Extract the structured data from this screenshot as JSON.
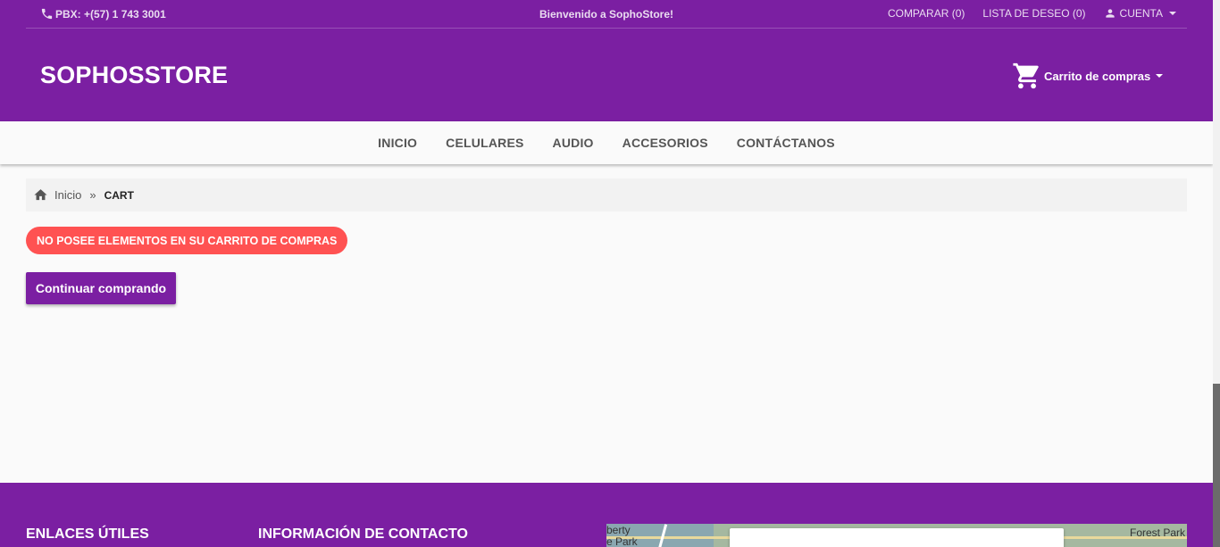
{
  "topbar": {
    "phone": "PBX: +(57) 1 743 3001",
    "welcome": "Bienvenido a SophoStore!",
    "compare": "COMPARAR (0)",
    "wishlist": "LISTA DE DESEO (0)",
    "account": "CUENTA"
  },
  "header": {
    "logo": "SOPHOSSTORE",
    "cart": "Carrito de compras"
  },
  "nav": {
    "items": [
      "INICIO",
      "CELULARES",
      "AUDIO",
      "ACCESORIOS",
      "CONTÁCTANOS"
    ]
  },
  "breadcrumb": {
    "home": "Inicio",
    "separator": "»",
    "current": "CART"
  },
  "cart_page": {
    "empty_message": "NO POSEE ELEMENTOS EN SU CARRITO DE COMPRAS",
    "continue_label": "Continuar comprando"
  },
  "footer": {
    "useful_links": "ENLACES ÚTILES",
    "contact_info": "INFORMACIÓN DE CONTACTO",
    "map_label_left": "berty\ne Park",
    "map_label_right": "Forest Park"
  },
  "colors": {
    "brand": "#7b1fa2",
    "alert": "#ff5252"
  },
  "icons": {
    "phone": "phone-icon",
    "account": "person-icon",
    "cart": "shopping-cart-icon",
    "home": "home-icon"
  }
}
